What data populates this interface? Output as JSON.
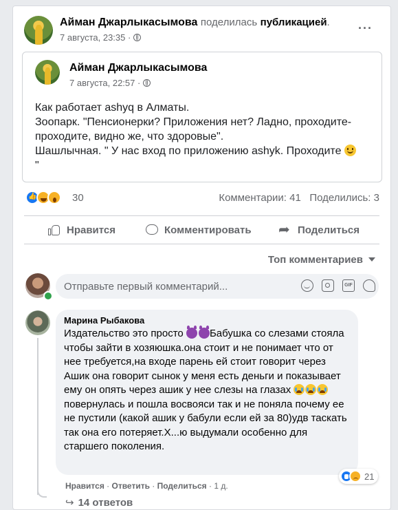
{
  "share_header": {
    "author": "Айман Джарлыкасымова",
    "verb": "поделилась",
    "object": "публикацией",
    "period": ".",
    "time": "7 августа, 23:35 ·",
    "more": "···"
  },
  "original_post": {
    "author": "Айман Джарлыкасымова",
    "time": "7 августа, 22:57 ·",
    "lines": [
      "Как работает ashyq в Алматы.",
      "Зоопарк. \"Пенсионерки? Приложения нет? Ладно, проходите-проходите, видно же, что здоровые\".",
      "Шашлычная. \" У нас вход по приложению ashyk. Проходите",
      "\""
    ]
  },
  "reactions": {
    "count": "30",
    "comments": "Комментарии: 41",
    "shares": "Поделились: 3"
  },
  "actions": {
    "like": "Нравится",
    "comment": "Комментировать",
    "share": "Поделиться"
  },
  "sort": {
    "label": "Топ комментариев"
  },
  "comment_box": {
    "placeholder": "Отправьте первый комментарий..."
  },
  "comment": {
    "author": "Марина Рыбакова",
    "text_1": "Издательство это просто",
    "text_2": "Бабушка со слезами стояла чтобы зайти в хозяюшка.она стоит и не понимает что от нее требуется,на входе парень ей стоит говорит через Ашик она говорит сынок у меня есть деньги и показывает ему он опять через ашик у нее слезы на глазах",
    "text_3": "повернулась и пошла восвояси так и не поняла почему ее не пустили (какой ашик у бабули если ей за 80)удв таскать так она его потеряет.Х...ю выдумали особенно для старшего поколения.",
    "like": "Нравится",
    "reply": "Ответить",
    "share": "Поделиться",
    "age": "1 д.",
    "sep": " · ",
    "reaction_count": "21",
    "replies": "14 ответов"
  },
  "colors": {
    "facebook_blue": "#1877f2",
    "secondary_text": "#65676b",
    "bubble": "#f0f2f5"
  }
}
